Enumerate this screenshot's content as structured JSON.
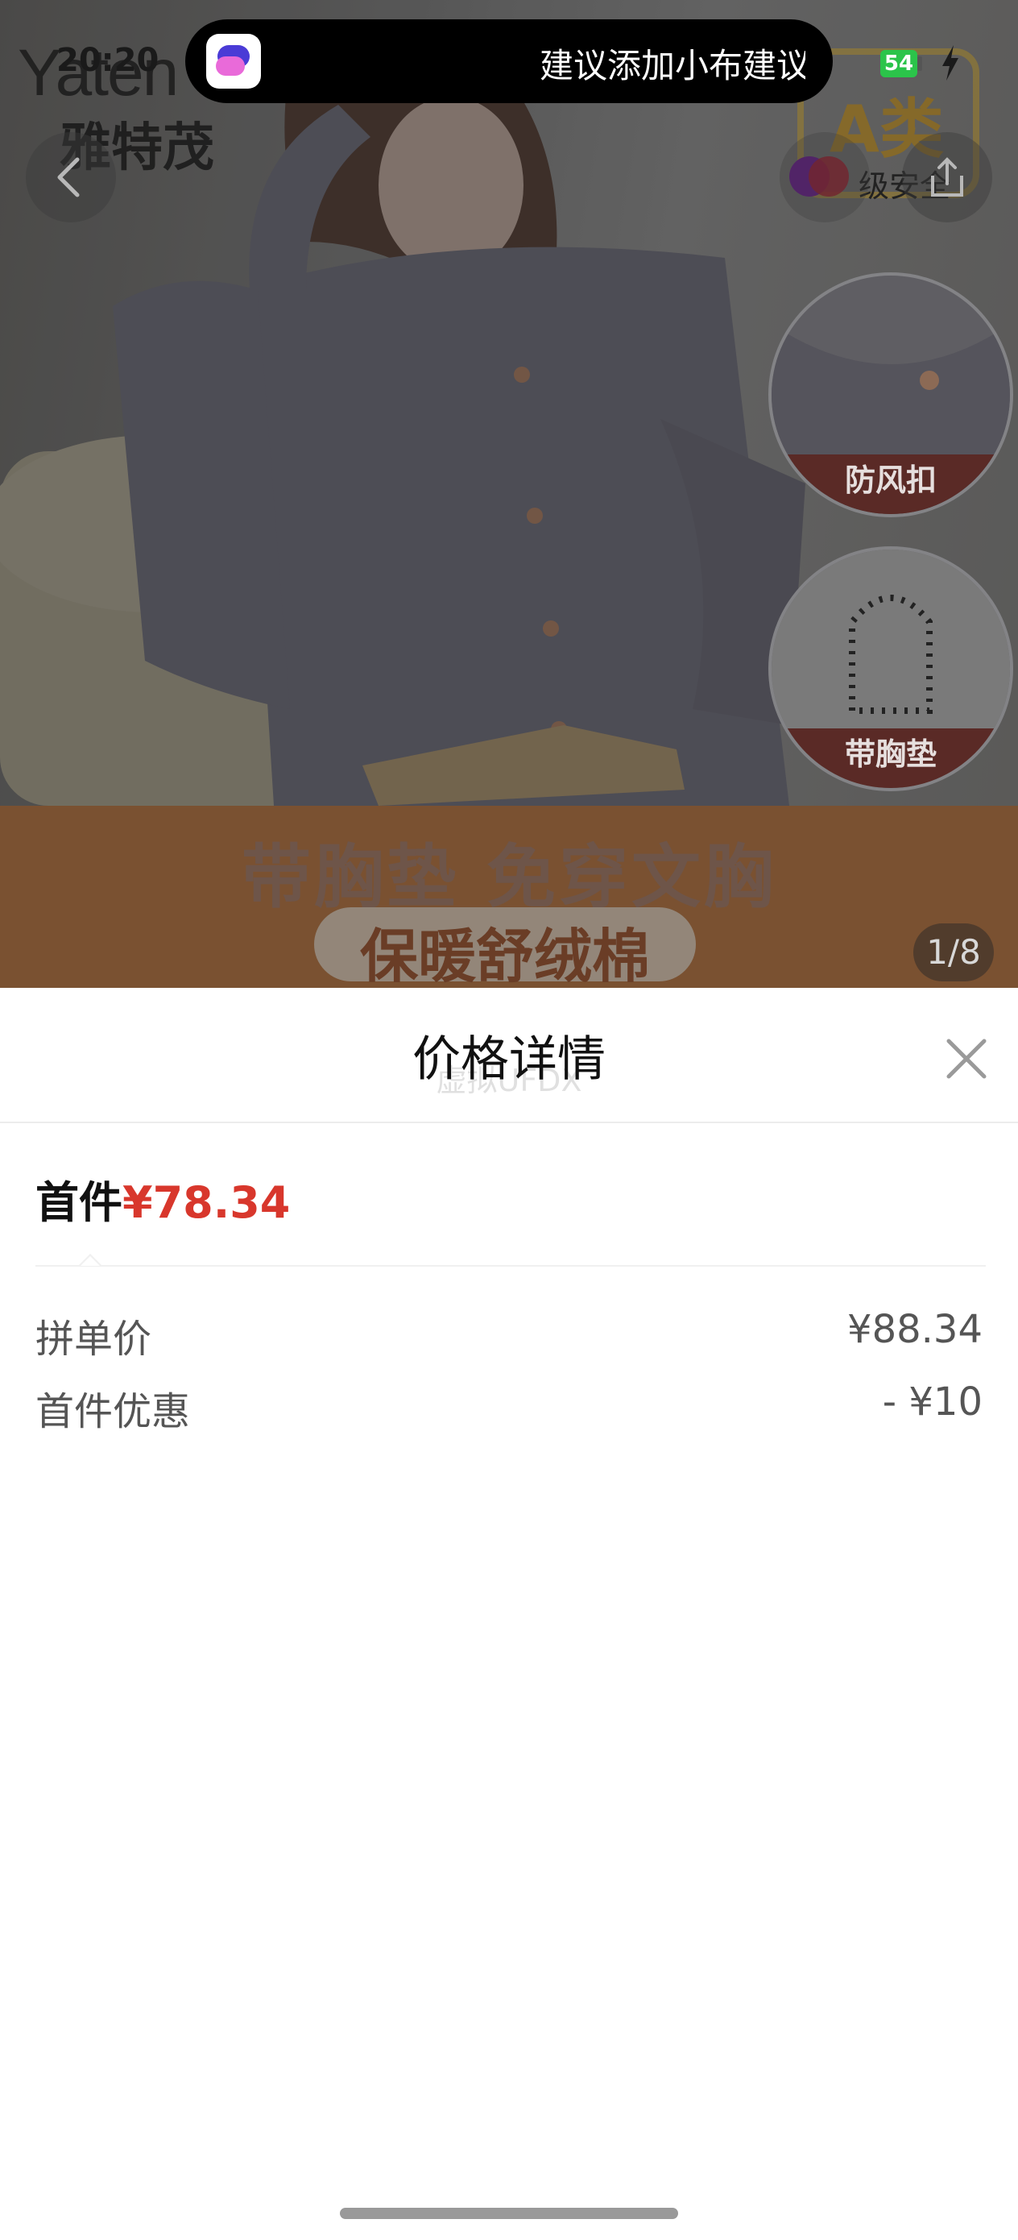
{
  "status_bar": {
    "time": "20:20",
    "battery_level": "54",
    "island_suggestion": "建议添加小布建议"
  },
  "hero": {
    "brand_logo": "Yaten",
    "brand_cn": "雅特茂",
    "badge_letter": "A类",
    "safety_label": "级安全",
    "detail_labels": [
      "防风扣",
      "带胸垫"
    ],
    "slogan": "带胸垫 免穿文胸",
    "sub_slogan": "保暖舒绒棉",
    "pager": "1/8"
  },
  "sheet": {
    "title": "价格详情",
    "ghost_text": "虚拟UFDX",
    "first_label": "首件",
    "first_amount": "¥78.34",
    "rows": [
      {
        "label": "拼单价",
        "value": "¥88.34"
      },
      {
        "label": "首件优惠",
        "value": "- ¥10"
      }
    ]
  },
  "colors": {
    "price_red": "#d8372c",
    "battery_green": "#2bc44a"
  },
  "icons": [
    "back-arrow-icon",
    "share-icon",
    "close-icon",
    "charging-bolt-icon",
    "assistant-app-icon"
  ]
}
